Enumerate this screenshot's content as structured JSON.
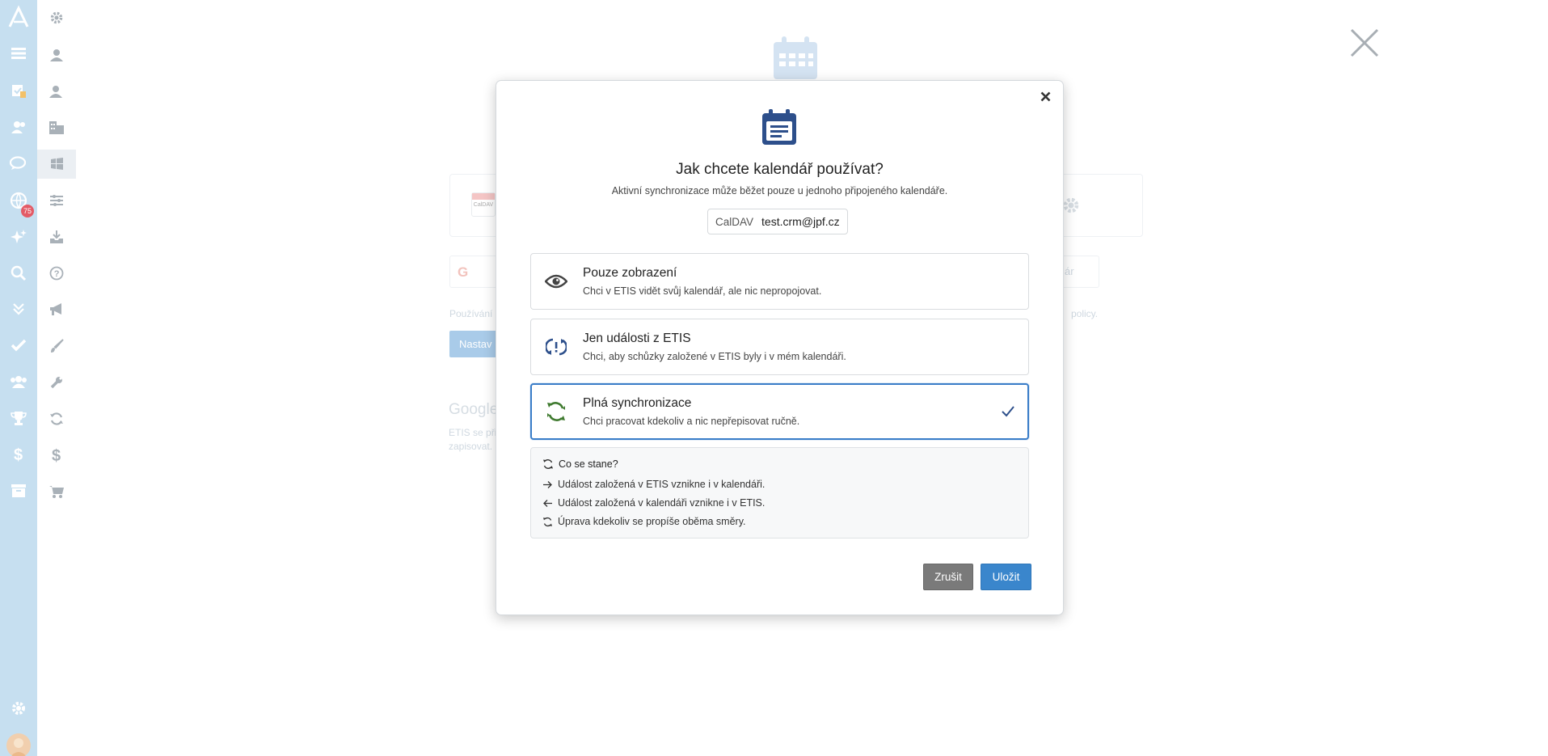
{
  "modal": {
    "title": "Jak chcete kalendář používat?",
    "subtitle": "Aktivní synchronizace může běžet pouze u jednoho připojeného kalendáře.",
    "account": {
      "type": "CalDAV",
      "email": "test.crm@jpf.cz"
    },
    "options": [
      {
        "title": "Pouze zobrazení",
        "description": "Chci v ETIS vidět svůj kalendář, ale nic nepropojovat.",
        "icon": "eye-icon",
        "selected": false
      },
      {
        "title": "Jen události z ETIS",
        "description": "Chci, aby schůzky založené v ETIS byly i v mém kalendáři.",
        "icon": "one-way-sync-icon",
        "selected": false
      },
      {
        "title": "Plná synchronizace",
        "description": "Chci pracovat kdekoliv a nic nepřepisovat ručně.",
        "icon": "sync-icon",
        "selected": true
      }
    ],
    "info": {
      "title": "Co se stane?",
      "rows": [
        {
          "icon": "arrow-right-icon",
          "text": "Událost založená v ETIS vznikne i v kalendáři."
        },
        {
          "icon": "arrow-left-icon",
          "text": "Událost založená v kalendáři vznikne i v ETIS."
        },
        {
          "icon": "sync-small-icon",
          "text": "Úprava kdekoliv se propíše oběma směry."
        }
      ]
    },
    "buttons": {
      "cancel": "Zrušit",
      "save": "Uložit"
    }
  },
  "sidebar": {
    "badge_count": "75"
  },
  "background": {
    "card_logo": "CalDAV",
    "google_field_left": "G",
    "google_field_right": "ár",
    "notice_left": "Používání",
    "notice_right": "policy.",
    "setup_button": "Nastav",
    "heading": "Google",
    "desc_line1": "ETIS se při",
    "desc_line2": "zapisovat."
  },
  "colors": {
    "accent": "#3a86cc",
    "selected_border": "#3a7dc8",
    "sync_green": "#3f7a2f",
    "etis_blue": "#2d4f8b",
    "rail": "#c6dff0"
  }
}
